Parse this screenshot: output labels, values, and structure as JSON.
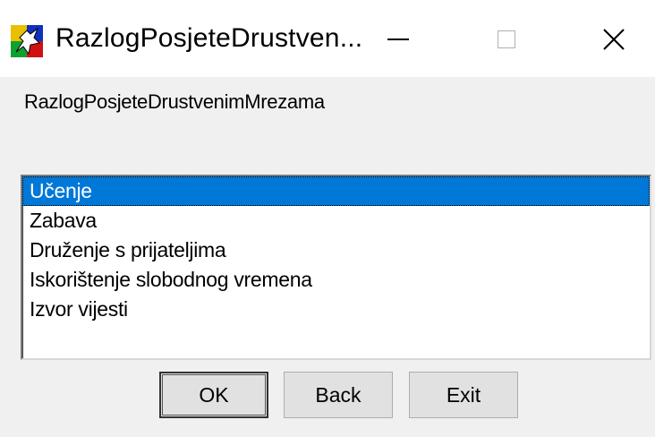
{
  "window": {
    "title": "RazlogPosjeteDrustven...",
    "controls": {
      "minimize": "minimize-icon",
      "maximize": "maximize-icon",
      "close": "close-icon"
    }
  },
  "form": {
    "caption": "RazlogPosjeteDrustvenimMrezama",
    "list": {
      "selected_index": 0,
      "items": [
        "Učenje",
        "Zabava",
        "Druženje s prijateljima",
        "Iskorištenje slobodnog vremena",
        "Izvor vijesti"
      ]
    },
    "buttons": {
      "ok": "OK",
      "back": "Back",
      "exit": "Exit"
    }
  },
  "colors": {
    "selection": "#0078d7",
    "face": "#f0f0f0"
  }
}
